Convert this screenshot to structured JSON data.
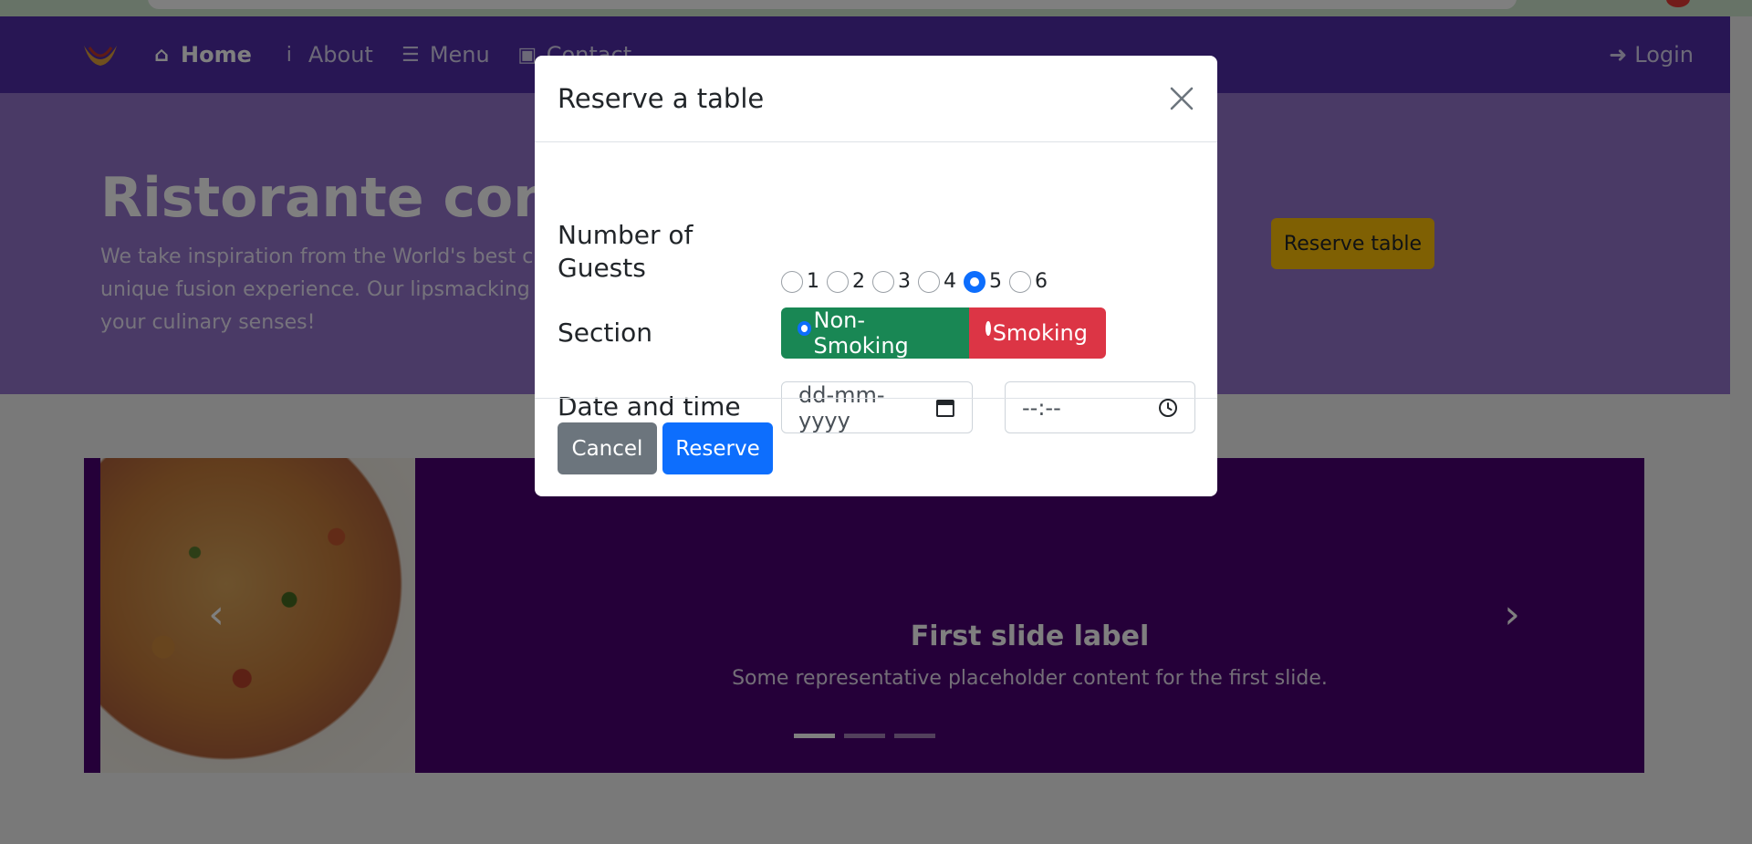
{
  "navbar": {
    "links": [
      {
        "label": "Home",
        "icon": "home-icon",
        "glyph": "⌂",
        "active": true
      },
      {
        "label": "About",
        "icon": "info-icon",
        "glyph": "i",
        "active": false
      },
      {
        "label": "Menu",
        "icon": "list-icon",
        "glyph": "☰",
        "active": false
      },
      {
        "label": "Contact",
        "icon": "address-card-icon",
        "glyph": "▣",
        "active": false
      }
    ],
    "login_label": "Login"
  },
  "jumbotron": {
    "title": "Ristorante con Fusion",
    "text": "We take inspiration from the World's best cuisines, and create a unique fusion experience. Our lipsmacking creations will tickle your culinary senses!",
    "button_label": "Reserve table"
  },
  "carousel": {
    "caption_title": "First slide label",
    "caption_text": "Some representative placeholder content for the first slide.",
    "indicators": 3,
    "active_index": 0
  },
  "modal": {
    "title": "Reserve a table",
    "guests_label": "Number of Guests",
    "guests_options": [
      "1",
      "2",
      "3",
      "4",
      "5",
      "6"
    ],
    "guests_selected": "5",
    "section_label": "Section",
    "section_options": [
      "Non-Smoking",
      "Smoking"
    ],
    "section_selected": "Non-Smoking",
    "datetime_label": "Date and time",
    "date_placeholder": "dd-mm-yyyy",
    "time_placeholder": "--:--",
    "cancel_label": "Cancel",
    "reserve_label": "Reserve"
  },
  "colors": {
    "navbar": "#512da8",
    "jumbotron": "#9575cd",
    "carousel": "#4a0072",
    "nonsmoking": "#198754",
    "smoking": "#dc3545",
    "primary": "#0d6efd",
    "secondary": "#6c757d",
    "warning": "#ffc107"
  }
}
